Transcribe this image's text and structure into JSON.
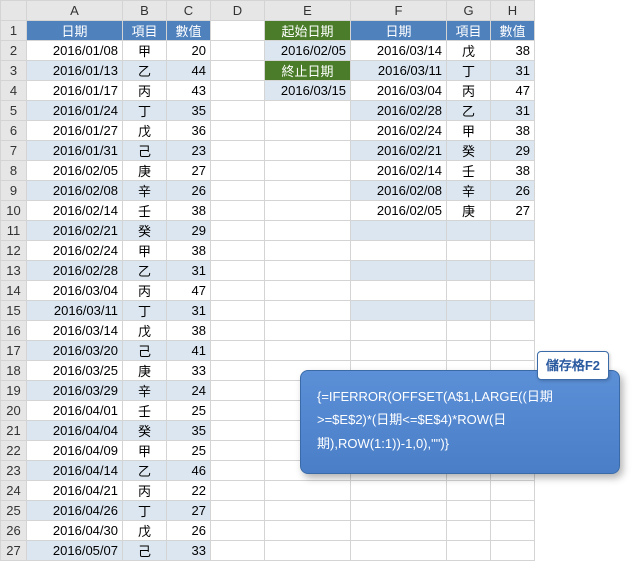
{
  "columns": [
    "A",
    "B",
    "C",
    "D",
    "E",
    "F",
    "G",
    "H"
  ],
  "headers_left": {
    "A": "日期",
    "B": "項目",
    "C": "數值"
  },
  "headers_right": {
    "F": "日期",
    "G": "項目",
    "H": "數值"
  },
  "green_labels": {
    "start": "起始日期",
    "end": "終止日期"
  },
  "green_values": {
    "start": "2016/02/05",
    "end": "2016/03/15"
  },
  "rows_left": [
    {
      "d": "2016/01/08",
      "i": "甲",
      "v": "20"
    },
    {
      "d": "2016/01/13",
      "i": "乙",
      "v": "44"
    },
    {
      "d": "2016/01/17",
      "i": "丙",
      "v": "43"
    },
    {
      "d": "2016/01/24",
      "i": "丁",
      "v": "35"
    },
    {
      "d": "2016/01/27",
      "i": "戊",
      "v": "36"
    },
    {
      "d": "2016/01/31",
      "i": "己",
      "v": "23"
    },
    {
      "d": "2016/02/05",
      "i": "庚",
      "v": "27"
    },
    {
      "d": "2016/02/08",
      "i": "辛",
      "v": "26"
    },
    {
      "d": "2016/02/14",
      "i": "壬",
      "v": "38"
    },
    {
      "d": "2016/02/21",
      "i": "癸",
      "v": "29"
    },
    {
      "d": "2016/02/24",
      "i": "甲",
      "v": "38"
    },
    {
      "d": "2016/02/28",
      "i": "乙",
      "v": "31"
    },
    {
      "d": "2016/03/04",
      "i": "丙",
      "v": "47"
    },
    {
      "d": "2016/03/11",
      "i": "丁",
      "v": "31"
    },
    {
      "d": "2016/03/14",
      "i": "戊",
      "v": "38"
    },
    {
      "d": "2016/03/20",
      "i": "己",
      "v": "41"
    },
    {
      "d": "2016/03/25",
      "i": "庚",
      "v": "33"
    },
    {
      "d": "2016/03/29",
      "i": "辛",
      "v": "24"
    },
    {
      "d": "2016/04/01",
      "i": "壬",
      "v": "25"
    },
    {
      "d": "2016/04/04",
      "i": "癸",
      "v": "35"
    },
    {
      "d": "2016/04/09",
      "i": "甲",
      "v": "25"
    },
    {
      "d": "2016/04/14",
      "i": "乙",
      "v": "46"
    },
    {
      "d": "2016/04/21",
      "i": "丙",
      "v": "22"
    },
    {
      "d": "2016/04/26",
      "i": "丁",
      "v": "27"
    },
    {
      "d": "2016/04/30",
      "i": "戊",
      "v": "26"
    },
    {
      "d": "2016/05/07",
      "i": "己",
      "v": "33"
    }
  ],
  "rows_right": [
    {
      "d": "2016/03/14",
      "i": "戊",
      "v": "38"
    },
    {
      "d": "2016/03/11",
      "i": "丁",
      "v": "31"
    },
    {
      "d": "2016/03/04",
      "i": "丙",
      "v": "47"
    },
    {
      "d": "2016/02/28",
      "i": "乙",
      "v": "31"
    },
    {
      "d": "2016/02/24",
      "i": "甲",
      "v": "38"
    },
    {
      "d": "2016/02/21",
      "i": "癸",
      "v": "29"
    },
    {
      "d": "2016/02/14",
      "i": "壬",
      "v": "38"
    },
    {
      "d": "2016/02/08",
      "i": "辛",
      "v": "26"
    },
    {
      "d": "2016/02/05",
      "i": "庚",
      "v": "27"
    }
  ],
  "right_blank_rows": 6,
  "tooltip": {
    "tag": "儲存格F2",
    "formula": "{=IFERROR(OFFSET(A$1,LARGE((日期>=$E$2)*(日期<=$E$4)*ROW(日期),ROW(1:1))-1,0),\"\")}"
  }
}
